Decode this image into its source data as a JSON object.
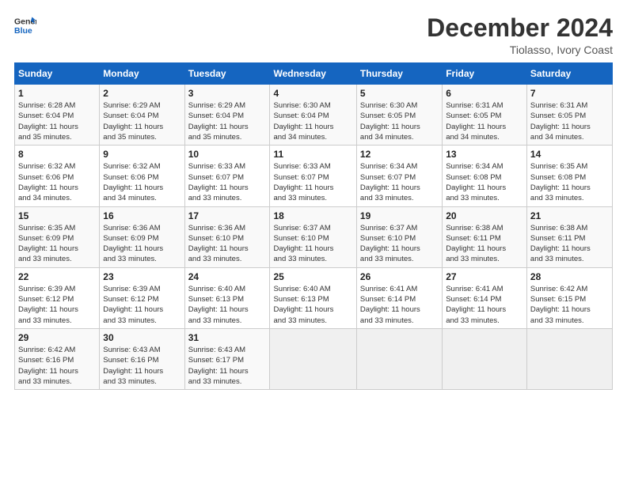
{
  "header": {
    "logo_line1": "General",
    "logo_line2": "Blue",
    "title": "December 2024",
    "subtitle": "Tiolasso, Ivory Coast"
  },
  "weekdays": [
    "Sunday",
    "Monday",
    "Tuesday",
    "Wednesday",
    "Thursday",
    "Friday",
    "Saturday"
  ],
  "weeks": [
    [
      {
        "day": "1",
        "lines": [
          "Sunrise: 6:28 AM",
          "Sunset: 6:04 PM",
          "Daylight: 11 hours",
          "and 35 minutes."
        ]
      },
      {
        "day": "2",
        "lines": [
          "Sunrise: 6:29 AM",
          "Sunset: 6:04 PM",
          "Daylight: 11 hours",
          "and 35 minutes."
        ]
      },
      {
        "day": "3",
        "lines": [
          "Sunrise: 6:29 AM",
          "Sunset: 6:04 PM",
          "Daylight: 11 hours",
          "and 35 minutes."
        ]
      },
      {
        "day": "4",
        "lines": [
          "Sunrise: 6:30 AM",
          "Sunset: 6:04 PM",
          "Daylight: 11 hours",
          "and 34 minutes."
        ]
      },
      {
        "day": "5",
        "lines": [
          "Sunrise: 6:30 AM",
          "Sunset: 6:05 PM",
          "Daylight: 11 hours",
          "and 34 minutes."
        ]
      },
      {
        "day": "6",
        "lines": [
          "Sunrise: 6:31 AM",
          "Sunset: 6:05 PM",
          "Daylight: 11 hours",
          "and 34 minutes."
        ]
      },
      {
        "day": "7",
        "lines": [
          "Sunrise: 6:31 AM",
          "Sunset: 6:05 PM",
          "Daylight: 11 hours",
          "and 34 minutes."
        ]
      }
    ],
    [
      {
        "day": "8",
        "lines": [
          "Sunrise: 6:32 AM",
          "Sunset: 6:06 PM",
          "Daylight: 11 hours",
          "and 34 minutes."
        ]
      },
      {
        "day": "9",
        "lines": [
          "Sunrise: 6:32 AM",
          "Sunset: 6:06 PM",
          "Daylight: 11 hours",
          "and 34 minutes."
        ]
      },
      {
        "day": "10",
        "lines": [
          "Sunrise: 6:33 AM",
          "Sunset: 6:07 PM",
          "Daylight: 11 hours",
          "and 33 minutes."
        ]
      },
      {
        "day": "11",
        "lines": [
          "Sunrise: 6:33 AM",
          "Sunset: 6:07 PM",
          "Daylight: 11 hours",
          "and 33 minutes."
        ]
      },
      {
        "day": "12",
        "lines": [
          "Sunrise: 6:34 AM",
          "Sunset: 6:07 PM",
          "Daylight: 11 hours",
          "and 33 minutes."
        ]
      },
      {
        "day": "13",
        "lines": [
          "Sunrise: 6:34 AM",
          "Sunset: 6:08 PM",
          "Daylight: 11 hours",
          "and 33 minutes."
        ]
      },
      {
        "day": "14",
        "lines": [
          "Sunrise: 6:35 AM",
          "Sunset: 6:08 PM",
          "Daylight: 11 hours",
          "and 33 minutes."
        ]
      }
    ],
    [
      {
        "day": "15",
        "lines": [
          "Sunrise: 6:35 AM",
          "Sunset: 6:09 PM",
          "Daylight: 11 hours",
          "and 33 minutes."
        ]
      },
      {
        "day": "16",
        "lines": [
          "Sunrise: 6:36 AM",
          "Sunset: 6:09 PM",
          "Daylight: 11 hours",
          "and 33 minutes."
        ]
      },
      {
        "day": "17",
        "lines": [
          "Sunrise: 6:36 AM",
          "Sunset: 6:10 PM",
          "Daylight: 11 hours",
          "and 33 minutes."
        ]
      },
      {
        "day": "18",
        "lines": [
          "Sunrise: 6:37 AM",
          "Sunset: 6:10 PM",
          "Daylight: 11 hours",
          "and 33 minutes."
        ]
      },
      {
        "day": "19",
        "lines": [
          "Sunrise: 6:37 AM",
          "Sunset: 6:10 PM",
          "Daylight: 11 hours",
          "and 33 minutes."
        ]
      },
      {
        "day": "20",
        "lines": [
          "Sunrise: 6:38 AM",
          "Sunset: 6:11 PM",
          "Daylight: 11 hours",
          "and 33 minutes."
        ]
      },
      {
        "day": "21",
        "lines": [
          "Sunrise: 6:38 AM",
          "Sunset: 6:11 PM",
          "Daylight: 11 hours",
          "and 33 minutes."
        ]
      }
    ],
    [
      {
        "day": "22",
        "lines": [
          "Sunrise: 6:39 AM",
          "Sunset: 6:12 PM",
          "Daylight: 11 hours",
          "and 33 minutes."
        ]
      },
      {
        "day": "23",
        "lines": [
          "Sunrise: 6:39 AM",
          "Sunset: 6:12 PM",
          "Daylight: 11 hours",
          "and 33 minutes."
        ]
      },
      {
        "day": "24",
        "lines": [
          "Sunrise: 6:40 AM",
          "Sunset: 6:13 PM",
          "Daylight: 11 hours",
          "and 33 minutes."
        ]
      },
      {
        "day": "25",
        "lines": [
          "Sunrise: 6:40 AM",
          "Sunset: 6:13 PM",
          "Daylight: 11 hours",
          "and 33 minutes."
        ]
      },
      {
        "day": "26",
        "lines": [
          "Sunrise: 6:41 AM",
          "Sunset: 6:14 PM",
          "Daylight: 11 hours",
          "and 33 minutes."
        ]
      },
      {
        "day": "27",
        "lines": [
          "Sunrise: 6:41 AM",
          "Sunset: 6:14 PM",
          "Daylight: 11 hours",
          "and 33 minutes."
        ]
      },
      {
        "day": "28",
        "lines": [
          "Sunrise: 6:42 AM",
          "Sunset: 6:15 PM",
          "Daylight: 11 hours",
          "and 33 minutes."
        ]
      }
    ],
    [
      {
        "day": "29",
        "lines": [
          "Sunrise: 6:42 AM",
          "Sunset: 6:16 PM",
          "Daylight: 11 hours",
          "and 33 minutes."
        ]
      },
      {
        "day": "30",
        "lines": [
          "Sunrise: 6:43 AM",
          "Sunset: 6:16 PM",
          "Daylight: 11 hours",
          "and 33 minutes."
        ]
      },
      {
        "day": "31",
        "lines": [
          "Sunrise: 6:43 AM",
          "Sunset: 6:17 PM",
          "Daylight: 11 hours",
          "and 33 minutes."
        ]
      },
      null,
      null,
      null,
      null
    ]
  ]
}
